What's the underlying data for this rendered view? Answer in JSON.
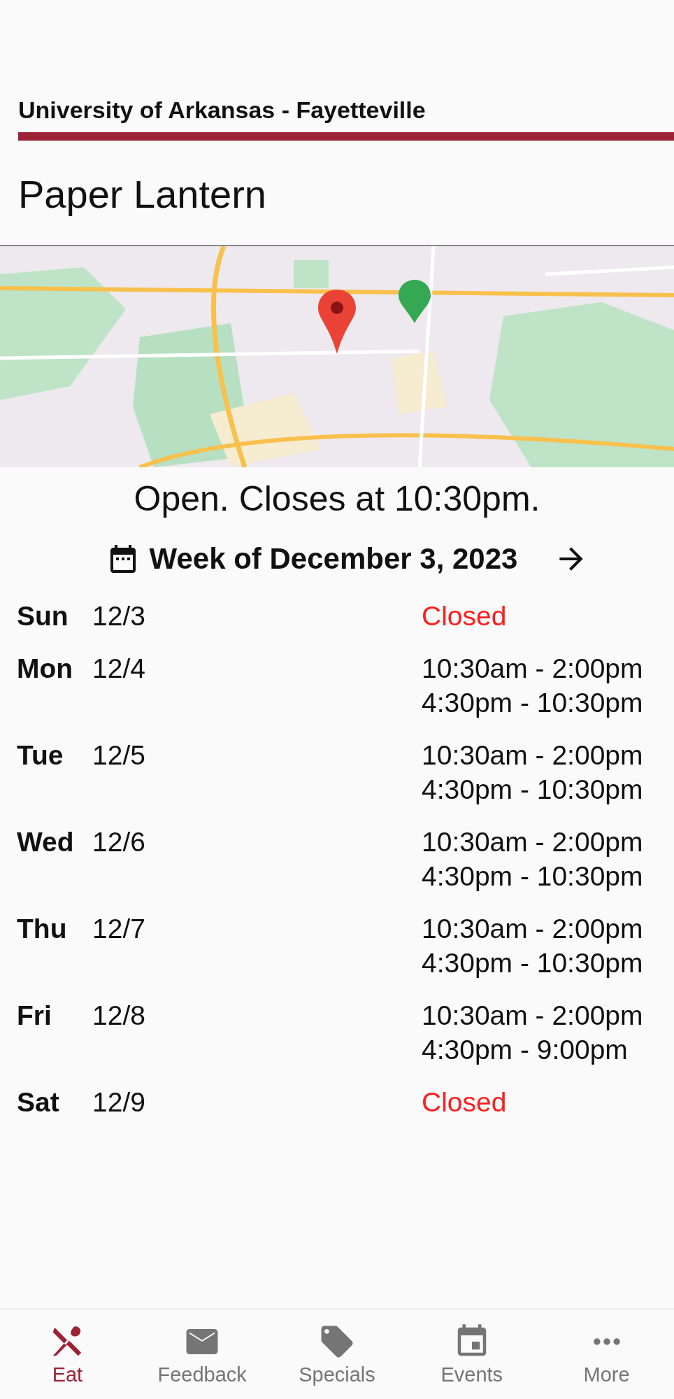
{
  "header": {
    "organization": "University of Arkansas - Fayetteville"
  },
  "venue": {
    "name": "Paper Lantern"
  },
  "status": "Open. Closes at 10:30pm.",
  "week": {
    "label": "Week of December 3, 2023"
  },
  "days": [
    {
      "day": "Sun",
      "date": "12/3",
      "closed": true,
      "hours": [
        "Closed"
      ]
    },
    {
      "day": "Mon",
      "date": "12/4",
      "closed": false,
      "hours": [
        "10:30am - 2:00pm",
        "4:30pm - 10:30pm"
      ]
    },
    {
      "day": "Tue",
      "date": "12/5",
      "closed": false,
      "hours": [
        "10:30am - 2:00pm",
        "4:30pm - 10:30pm"
      ]
    },
    {
      "day": "Wed",
      "date": "12/6",
      "closed": false,
      "hours": [
        "10:30am - 2:00pm",
        "4:30pm - 10:30pm"
      ]
    },
    {
      "day": "Thu",
      "date": "12/7",
      "closed": false,
      "hours": [
        "10:30am - 2:00pm",
        "4:30pm - 10:30pm"
      ]
    },
    {
      "day": "Fri",
      "date": "12/8",
      "closed": false,
      "hours": [
        "10:30am - 2:00pm",
        "4:30pm - 9:00pm"
      ]
    },
    {
      "day": "Sat",
      "date": "12/9",
      "closed": true,
      "hours": [
        "Closed"
      ]
    }
  ],
  "nav": [
    {
      "label": "Eat",
      "kind": "eat",
      "selected": true
    },
    {
      "label": "Feedback",
      "kind": "feedback",
      "selected": false
    },
    {
      "label": "Specials",
      "kind": "specials",
      "selected": false
    },
    {
      "label": "Events",
      "kind": "events",
      "selected": false
    },
    {
      "label": "More",
      "kind": "more",
      "selected": false
    }
  ]
}
